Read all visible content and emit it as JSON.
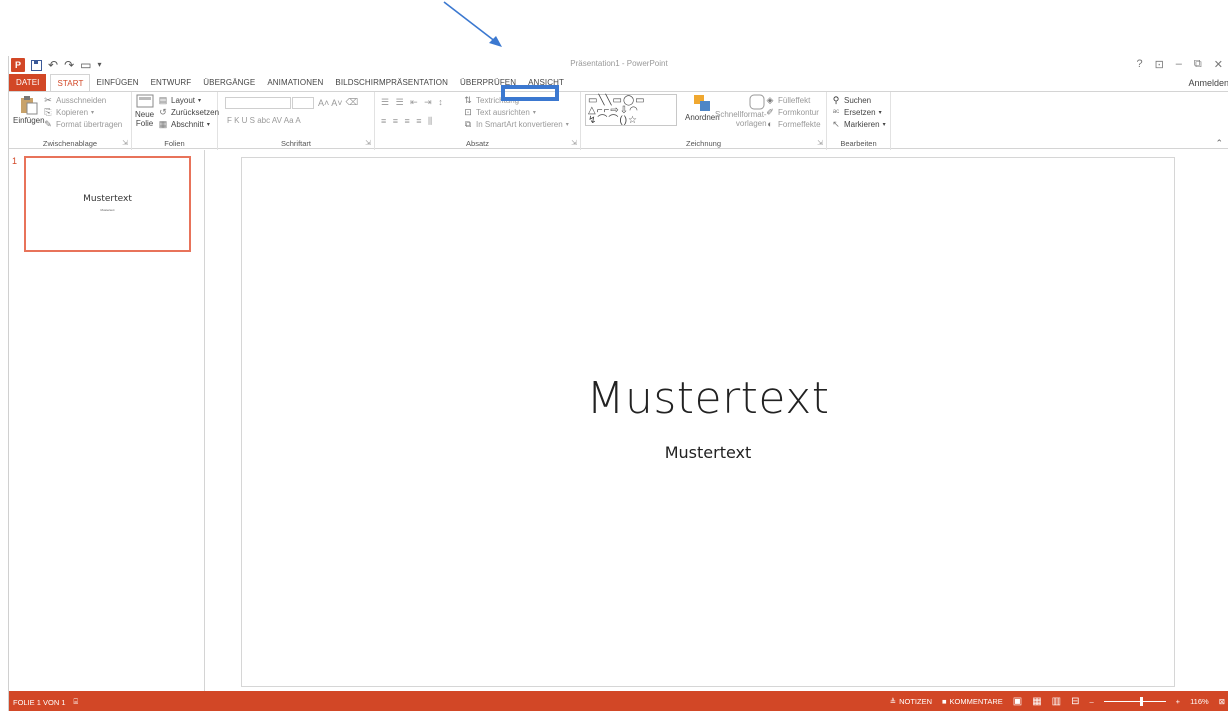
{
  "window": {
    "title": "Präsentation1 - PowerPoint",
    "sign_in": "Anmelden",
    "controls": [
      "?",
      "⊡",
      "–",
      "⧉",
      "✕"
    ]
  },
  "tabs": {
    "file": "DATEI",
    "items": [
      "START",
      "EINFÜGEN",
      "ENTWURF",
      "ÜBERGÄNGE",
      "ANIMATIONEN",
      "BILDSCHIRMPRÄSENTATION",
      "ÜBERPRÜFEN",
      "ANSICHT"
    ],
    "active": "START",
    "highlighted": "ANSICHT"
  },
  "ribbon": {
    "clipboard": {
      "label": "Zwischenablage",
      "paste": "Einfügen",
      "cut": "Ausschneiden",
      "copy": "Kopieren",
      "format_painter": "Format übertragen"
    },
    "slides": {
      "label": "Folien",
      "new_slide_line1": "Neue",
      "new_slide_line2": "Folie",
      "layout": "Layout",
      "reset": "Zurücksetzen",
      "section": "Abschnitt"
    },
    "font": {
      "label": "Schriftart",
      "format_letters": "F  K  U  S  abc  AV  Aa  A"
    },
    "paragraph": {
      "label": "Absatz",
      "text_direction": "Textrichtung",
      "align_text": "Text ausrichten",
      "smartart": "In SmartArt konvertieren"
    },
    "drawing": {
      "label": "Zeichnung",
      "arrange": "Anordnen",
      "quick_styles_line1": "Schnellformat-",
      "quick_styles_line2": "vorlagen",
      "fill": "Fülleffekt",
      "outline": "Formkontur",
      "effects": "Formeffekte"
    },
    "editing": {
      "label": "Bearbeiten",
      "find": "Suchen",
      "replace": "Ersetzen",
      "select": "Markieren"
    }
  },
  "thumbnails": [
    {
      "number": "1",
      "title": "Mustertext",
      "subtitle": "Mustertext"
    }
  ],
  "slide": {
    "title": "Mustertext",
    "subtitle": "Mustertext"
  },
  "statusbar": {
    "slide_info": "FOLIE 1 VON 1",
    "notes": "NOTIZEN",
    "comments": "KOMMENTARE",
    "zoom": "116%",
    "zoom_level": 0.58
  },
  "colors": {
    "accent": "#d24726",
    "highlight": "#3b78d0"
  }
}
